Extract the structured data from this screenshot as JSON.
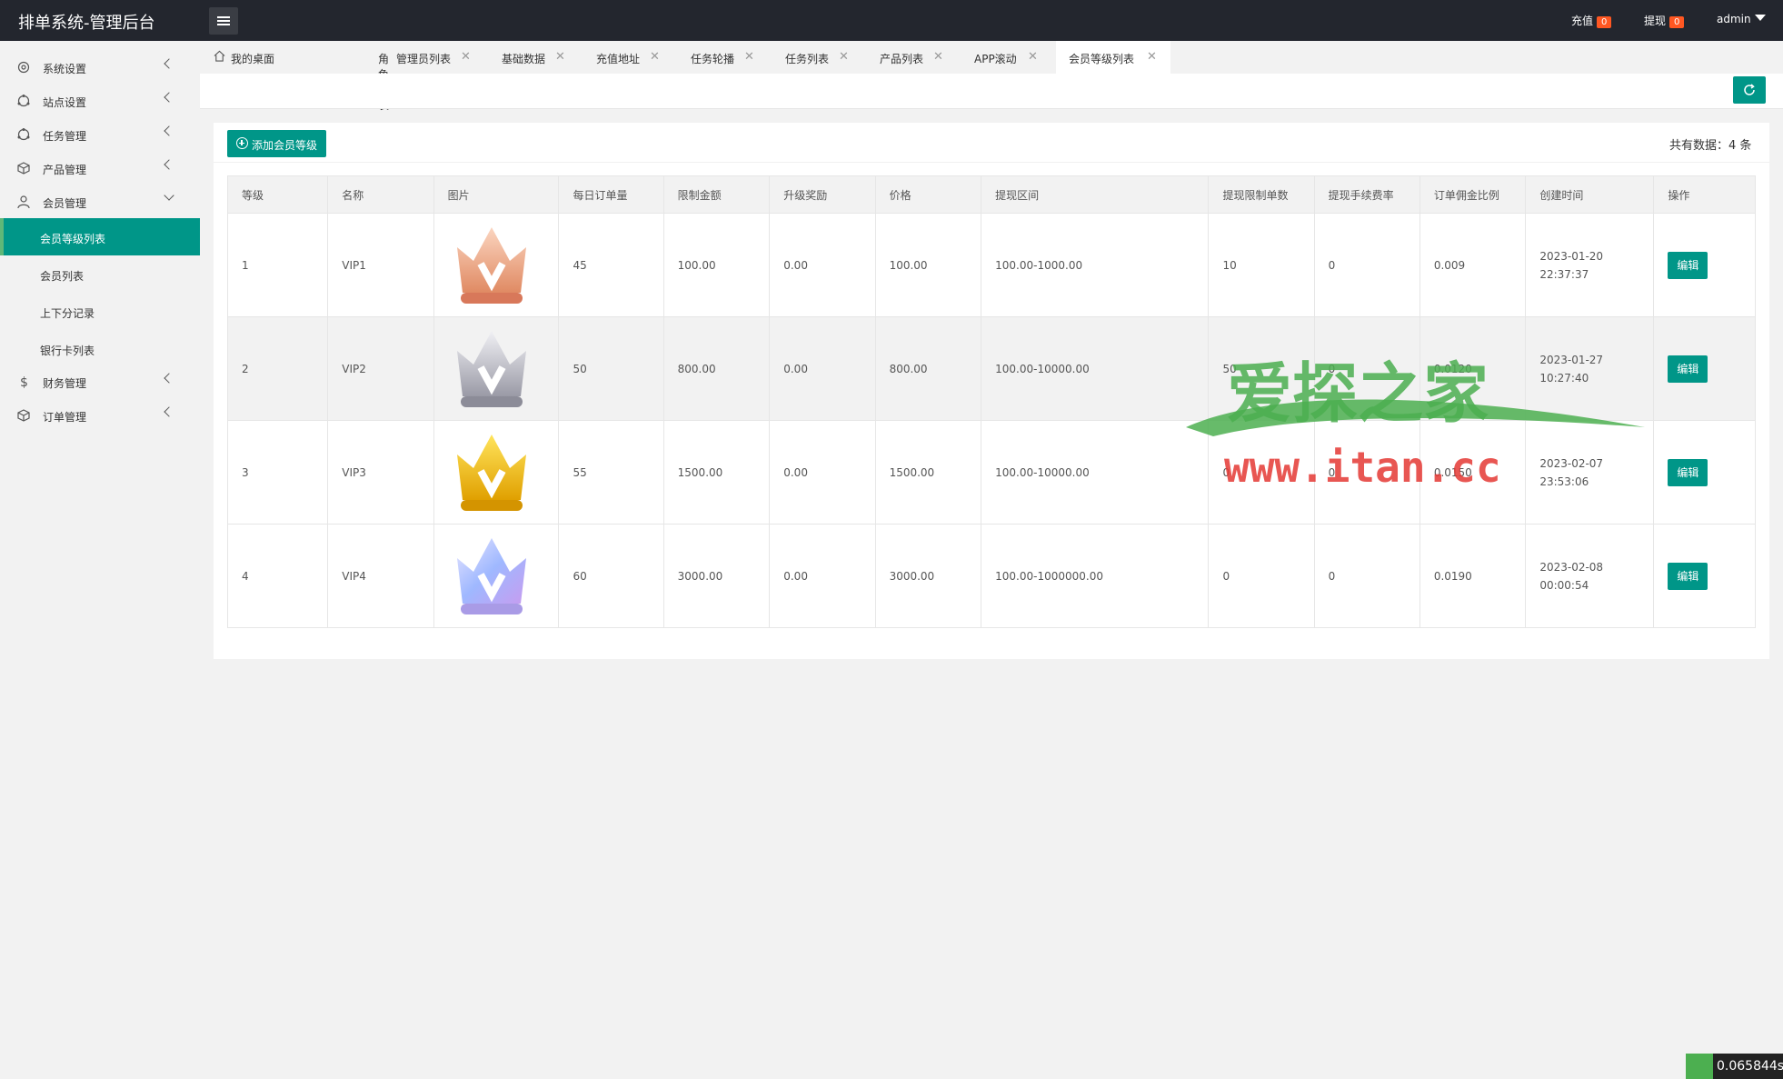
{
  "header": {
    "brand": "排单系统-管理后台",
    "recharge_label": "充值",
    "recharge_count": "0",
    "withdraw_label": "提现",
    "withdraw_count": "0",
    "user": "admin"
  },
  "sidebar": {
    "items": [
      {
        "label": "系统设置",
        "icon": "gear-icon"
      },
      {
        "label": "站点设置",
        "icon": "site-icon"
      },
      {
        "label": "任务管理",
        "icon": "task-icon"
      },
      {
        "label": "产品管理",
        "icon": "box-icon"
      },
      {
        "label": "会员管理",
        "icon": "user-icon"
      },
      {
        "label": "财务管理",
        "icon": "dollar-icon"
      },
      {
        "label": "订单管理",
        "icon": "order-icon"
      }
    ],
    "member_sub": [
      "会员等级列表",
      "会员列表",
      "上下分记录",
      "银行卡列表"
    ]
  },
  "tabs": [
    "我的桌面",
    "角色列表",
    "管理员列表",
    "基础数据",
    "充值地址",
    "任务轮播",
    "任务列表",
    "产品列表",
    "APP滚动",
    "会员等级列表"
  ],
  "toolbar": {
    "add_label": "添加会员等级",
    "total": "共有数据：4 条"
  },
  "table": {
    "columns": [
      "等级",
      "名称",
      "图片",
      "每日订单量",
      "限制金额",
      "升级奖励",
      "价格",
      "提现区间",
      "提现限制单数",
      "提现手续费率",
      "订单佣金比例",
      "创建时间",
      "操作"
    ],
    "edit_label": "编辑",
    "rows": [
      {
        "level": "1",
        "name": "VIP1",
        "crown": "bronze",
        "daily": "45",
        "limit": "100.00",
        "reward": "0.00",
        "price": "100.00",
        "range": "100.00-1000.00",
        "wlimit": "10",
        "fee": "0",
        "commission": "0.009",
        "created": "2023-01-20 22:37:37"
      },
      {
        "level": "2",
        "name": "VIP2",
        "crown": "silver",
        "daily": "50",
        "limit": "800.00",
        "reward": "0.00",
        "price": "800.00",
        "range": "100.00-10000.00",
        "wlimit": "50",
        "fee": "0",
        "commission": "0.0120",
        "created": "2023-01-27 10:27:40"
      },
      {
        "level": "3",
        "name": "VIP3",
        "crown": "gold",
        "daily": "55",
        "limit": "1500.00",
        "reward": "0.00",
        "price": "1500.00",
        "range": "100.00-10000.00",
        "wlimit": "0",
        "fee": "0",
        "commission": "0.0150",
        "created": "2023-02-07 23:53:06"
      },
      {
        "level": "4",
        "name": "VIP4",
        "crown": "crystal",
        "daily": "60",
        "limit": "3000.00",
        "reward": "0.00",
        "price": "3000.00",
        "range": "100.00-1000000.00",
        "wlimit": "0",
        "fee": "0",
        "commission": "0.0190",
        "created": "2023-02-08 00:00:54"
      }
    ]
  },
  "watermark": {
    "line1": "爱探之家",
    "line2": "www.itan.cc"
  },
  "timer": "0.065844s",
  "colors": {
    "primary": "#009688",
    "topbar": "#23262e",
    "badge": "#ff5722"
  }
}
